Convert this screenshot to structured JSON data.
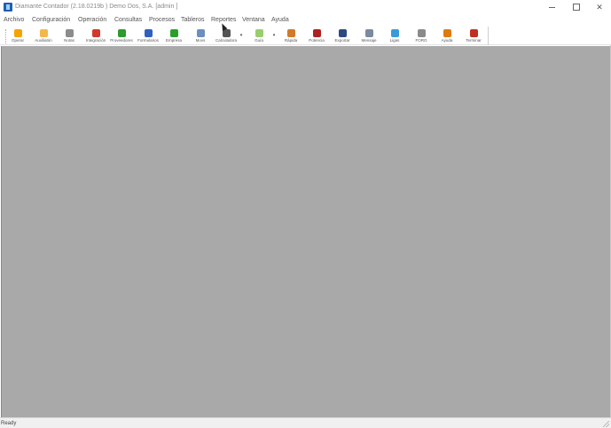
{
  "window": {
    "title": "Diamante Contador (2.18.0219b ) Demo Dos, S.A. [admin ]",
    "app_icon": "app-icon"
  },
  "menu": [
    "Archivo",
    "Configuración",
    "Operación",
    "Consultas",
    "Procesos",
    "Tableros",
    "Reportes",
    "Ventana",
    "Ayuda"
  ],
  "toolbar": {
    "buttons": [
      {
        "label": "Operar",
        "icon": "lightning-icon",
        "color": "#f5a300"
      },
      {
        "label": "Auxiliatón",
        "icon": "folder-icon",
        "color": "#f2b84a"
      },
      {
        "label": "Notas",
        "icon": "notes-icon",
        "color": "#8c8c8c"
      },
      {
        "label": "Integración",
        "icon": "integration-icon",
        "color": "#d0392b"
      },
      {
        "label": "Proveedores",
        "icon": "providers-icon",
        "color": "#2e9a2e"
      },
      {
        "label": "Formularios",
        "icon": "forms-icon",
        "color": "#3060c0"
      },
      {
        "label": "Empresa",
        "icon": "refresh-icon",
        "color": "#2aa02a"
      },
      {
        "label": "Movs",
        "icon": "crop-icon",
        "color": "#6b8fbf"
      },
      {
        "label": "Calculadora",
        "icon": "calculator-icon",
        "color": "#555555"
      },
      {
        "label": "Guía",
        "icon": "chat-icon",
        "color": "#9acd6e"
      },
      {
        "label": "Rápida",
        "icon": "rocket-icon",
        "color": "#d07a2a"
      },
      {
        "label": "Potencia",
        "icon": "magnet-icon",
        "color": "#b02020"
      },
      {
        "label": "Exportar",
        "icon": "export-icon",
        "color": "#2b4a80"
      },
      {
        "label": "Mensaje",
        "icon": "message-icon",
        "color": "#7a8aa0"
      },
      {
        "label": "Ligas",
        "icon": "links-icon",
        "color": "#3a9ad9"
      },
      {
        "label": "FORO",
        "icon": "forum-icon",
        "color": "#8a8a8a"
      },
      {
        "label": "Ayuda",
        "icon": "help-icon",
        "color": "#e07a10"
      },
      {
        "label": "Terminar",
        "icon": "exit-icon",
        "color": "#c03020"
      }
    ]
  },
  "status": {
    "text": "Ready"
  }
}
